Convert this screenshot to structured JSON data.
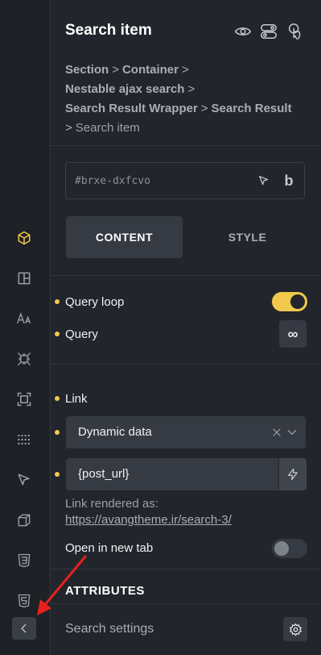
{
  "sidebar": {
    "icons": [
      "box-icon",
      "layout-icon",
      "typography-icon",
      "spacing-icon",
      "frame-icon",
      "grid-dots-icon",
      "cursor-icon",
      "cube-icon",
      "css3-icon",
      "html5-icon"
    ],
    "collapse": "chevron-left-icon"
  },
  "header": {
    "title": "Search item",
    "icons": [
      "eye-icon",
      "toggle-icon",
      "hand-pointer-icon"
    ],
    "breadcrumb": [
      "Section",
      "Container",
      "Nestable ajax search",
      "Search Result Wrapper",
      "Search Result",
      "Search item"
    ],
    "separator": ">"
  },
  "id_field": {
    "value": "#brxe-dxfcvo",
    "bold_label": "b"
  },
  "tabs": {
    "content": "CONTENT",
    "style": "STYLE"
  },
  "controls": {
    "query_loop": {
      "label": "Query loop",
      "on": true
    },
    "query": {
      "label": "Query",
      "button_symbol": "∞"
    },
    "link": {
      "label": "Link",
      "type_value": "Dynamic data",
      "input_value": "{post_url}",
      "rendered_label": "Link rendered as:",
      "rendered_url": "https://avangtheme.ir/search-3/"
    },
    "open_new_tab": {
      "label": "Open in new tab",
      "on": false
    }
  },
  "attributes_title": "ATTRIBUTES",
  "footer": {
    "label": "Search settings"
  },
  "colors": {
    "accent": "#f2c94c",
    "annotation_arrow": "#e8201e"
  }
}
